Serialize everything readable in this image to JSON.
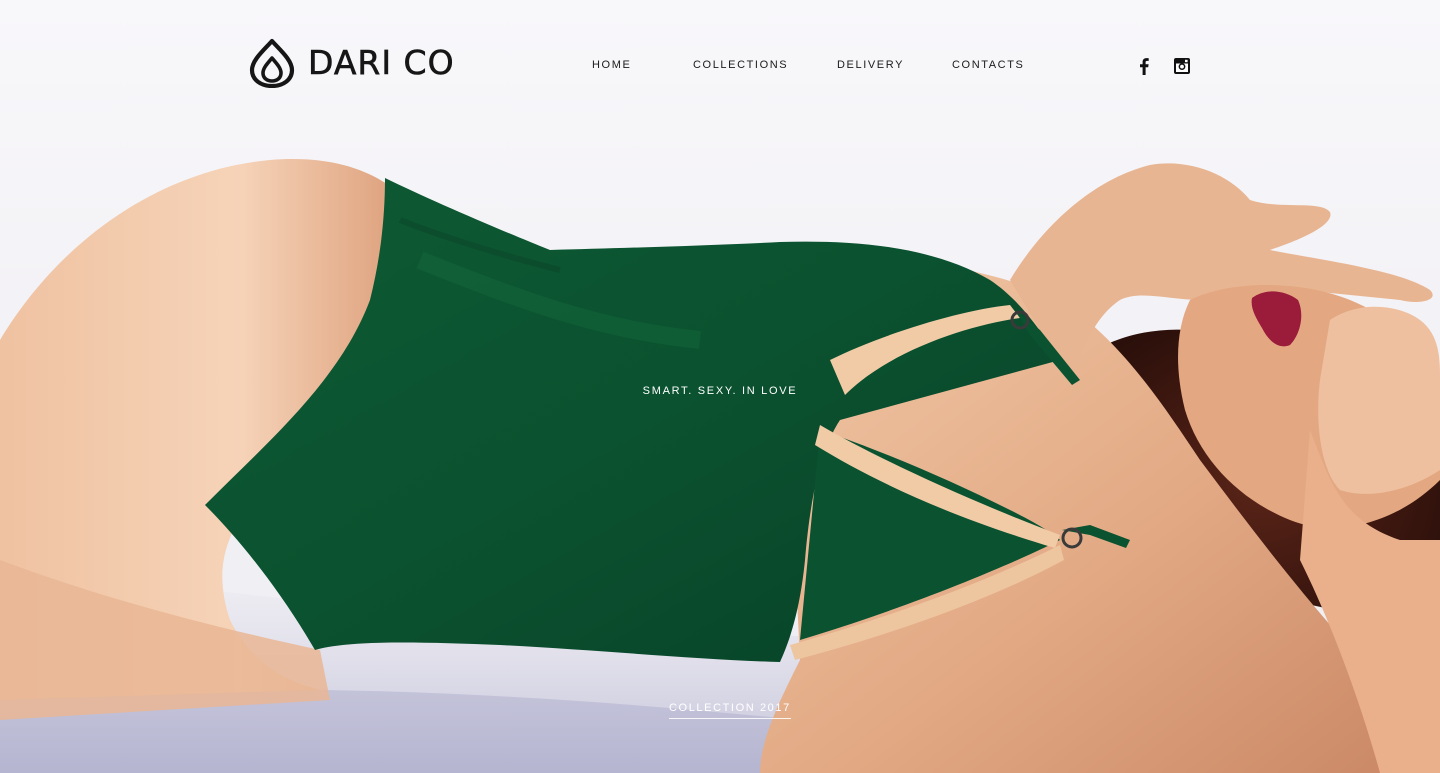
{
  "brand": {
    "name": "DARI CO",
    "logo_icon": "drop-logo-icon"
  },
  "nav": {
    "items": [
      {
        "label": "HOME"
      },
      {
        "label": "COLLECTIONS"
      },
      {
        "label": "DELIVERY"
      },
      {
        "label": "CONTACTS"
      }
    ]
  },
  "social": {
    "facebook_icon": "facebook-icon",
    "instagram_icon": "instagram-icon"
  },
  "hero": {
    "tagline": "SMART. SEXY. IN LOVE",
    "collection_link": "COLLECTION 2017"
  },
  "colors": {
    "background": "#f6f5f8",
    "text_dark": "#1a1a1a",
    "text_light": "#ffffff",
    "swimsuit_green": "#0f5b35",
    "skin": "#e6b08a"
  }
}
